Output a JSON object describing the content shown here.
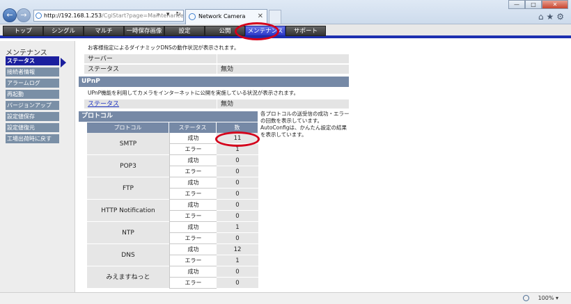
{
  "browser": {
    "address_host": "http://192.168.1.253",
    "address_rest": "/CgiStart?page=Maintenance&...",
    "address_tools": "⌕ ▾ ↻ ✕",
    "tab_title": "Network Camera",
    "tab_close": "✕",
    "back": "←",
    "forward": "→",
    "win_min": "—",
    "win_max": "□",
    "win_close": "✕",
    "tools": "⌂★⚙",
    "zoom": "100%",
    "zoom_caret": "▾"
  },
  "topnav": [
    {
      "label": "トップ",
      "active": false
    },
    {
      "label": "シングル",
      "active": false
    },
    {
      "label": "マルチ",
      "active": false
    },
    {
      "label": "一時保存画像",
      "active": false
    },
    {
      "label": "設定",
      "active": false
    },
    {
      "label": "公開",
      "active": false
    },
    {
      "label": "メンテナンス",
      "active": true
    },
    {
      "label": "サポート",
      "active": false
    }
  ],
  "sidebar": {
    "title": "メンテナンス",
    "items": [
      {
        "label": "ステータス",
        "active": true
      },
      {
        "label": "接続者情報",
        "active": false
      },
      {
        "label": "アラームログ",
        "active": false
      },
      {
        "label": "再起動",
        "active": false
      },
      {
        "label": "バージョンアップ",
        "active": false
      },
      {
        "label": "設定値保存",
        "active": false
      },
      {
        "label": "設定値復元",
        "active": false
      },
      {
        "label": "工場出荷時に戻す",
        "active": false
      }
    ]
  },
  "ddns": {
    "desc": "お客様指定によるダイナミックDNSの動作状況が表示されます。",
    "server_label": "サーバー",
    "server_value": "",
    "status_label": "ステータス",
    "status_value": "無効"
  },
  "upnp": {
    "heading": "UPnP",
    "desc": "UPnP機能を利用してカメラをインターネットに公開を実施している状況が表示されます。",
    "status_label": "ステータス",
    "status_value": "無効"
  },
  "protocol": {
    "heading": "プロトコル",
    "col_protocol": "プロトコル",
    "col_status": "ステータス",
    "col_count": "数",
    "note": "各プロトコルの送受信の成功・エラーの回数を表示しています。AutoConfigは、かんたん設定の結果を表示しています。",
    "rows": [
      {
        "name": "SMTP",
        "success_label": "成功",
        "success": "11",
        "error_label": "エラー",
        "error": "1"
      },
      {
        "name": "POP3",
        "success_label": "成功",
        "success": "0",
        "error_label": "エラー",
        "error": "0"
      },
      {
        "name": "FTP",
        "success_label": "成功",
        "success": "0",
        "error_label": "エラー",
        "error": "0"
      },
      {
        "name": "HTTP Notification",
        "success_label": "成功",
        "success": "0",
        "error_label": "エラー",
        "error": "0"
      },
      {
        "name": "NTP",
        "success_label": "成功",
        "success": "1",
        "error_label": "エラー",
        "error": "0"
      },
      {
        "name": "DNS",
        "success_label": "成功",
        "success": "12",
        "error_label": "エラー",
        "error": "1"
      },
      {
        "name": "みえますねっと",
        "success_label": "成功",
        "success": "0",
        "error_label": "エラー",
        "error": "0"
      }
    ]
  },
  "colors": {
    "nav_active": "#2a36c8",
    "nav_border": "#1c2fb0",
    "section_header": "#7689a6",
    "highlight_circle": "#d4001b"
  }
}
